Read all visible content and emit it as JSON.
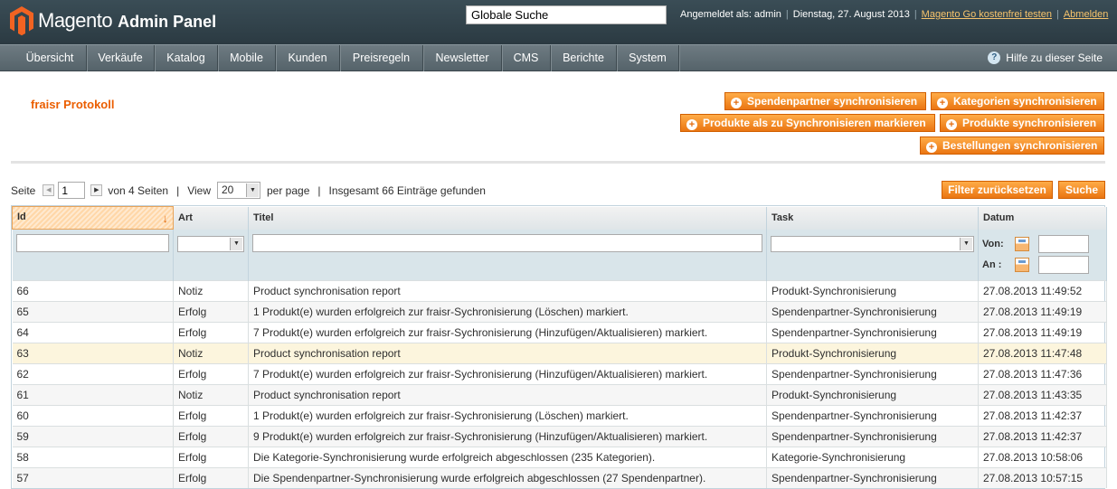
{
  "header": {
    "logo_text": "Magento",
    "logo_sub": "Admin Panel",
    "search_value": "Globale Suche",
    "logged_in": "Angemeldet als: admin",
    "date": "Dienstag, 27. August 2013",
    "go_link": "Magento Go kostenfrei testen",
    "logout": "Abmelden"
  },
  "nav": {
    "items": [
      "Übersicht",
      "Verkäufe",
      "Katalog",
      "Mobile",
      "Kunden",
      "Preisregeln",
      "Newsletter",
      "CMS",
      "Berichte",
      "System"
    ],
    "help": "Hilfe zu dieser Seite"
  },
  "page": {
    "title": "fraisr Protokoll",
    "buttons": {
      "sync_partners": "Spendenpartner synchronisieren",
      "sync_categories": "Kategorien synchronisieren",
      "mark_products": "Produkte als zu Synchronisieren markieren",
      "sync_products": "Produkte synchronisieren",
      "sync_orders": "Bestellungen synchronisieren"
    }
  },
  "pager": {
    "page_label": "Seite",
    "page_value": "1",
    "of_pages": "von 4 Seiten",
    "view_label": "View",
    "view_value": "20",
    "per_page": "per page",
    "total": "Insgesamt 66 Einträge gefunden",
    "reset_filter": "Filter zurücksetzen",
    "search": "Suche"
  },
  "grid": {
    "columns": [
      "Id",
      "Art",
      "Titel",
      "Task",
      "Datum"
    ],
    "date_from": "Von:",
    "date_to": "An :",
    "rows": [
      [
        "66",
        "Notiz",
        "Product synchronisation report",
        "Produkt-Synchronisierung",
        "27.08.2013 11:49:52"
      ],
      [
        "65",
        "Erfolg",
        "1 Produkt(e) wurden erfolgreich zur fraisr-Sychronisierung (Löschen) markiert.",
        "Spendenpartner-Synchronisierung",
        "27.08.2013 11:49:19"
      ],
      [
        "64",
        "Erfolg",
        "7 Produkt(e) wurden erfolgreich zur fraisr-Sychronisierung (Hinzufügen/Aktualisieren) markiert.",
        "Spendenpartner-Synchronisierung",
        "27.08.2013 11:49:19"
      ],
      [
        "63",
        "Notiz",
        "Product synchronisation report",
        "Produkt-Synchronisierung",
        "27.08.2013 11:47:48"
      ],
      [
        "62",
        "Erfolg",
        "7 Produkt(e) wurden erfolgreich zur fraisr-Sychronisierung (Hinzufügen/Aktualisieren) markiert.",
        "Spendenpartner-Synchronisierung",
        "27.08.2013 11:47:36"
      ],
      [
        "61",
        "Notiz",
        "Product synchronisation report",
        "Produkt-Synchronisierung",
        "27.08.2013 11:43:35"
      ],
      [
        "60",
        "Erfolg",
        "1 Produkt(e) wurden erfolgreich zur fraisr-Sychronisierung (Löschen) markiert.",
        "Spendenpartner-Synchronisierung",
        "27.08.2013 11:42:37"
      ],
      [
        "59",
        "Erfolg",
        "9 Produkt(e) wurden erfolgreich zur fraisr-Sychronisierung (Hinzufügen/Aktualisieren) markiert.",
        "Spendenpartner-Synchronisierung",
        "27.08.2013 11:42:37"
      ],
      [
        "58",
        "Erfolg",
        "Die Kategorie-Synchronisierung wurde erfolgreich abgeschlossen (235 Kategorien).",
        "Kategorie-Synchronisierung",
        "27.08.2013 10:58:06"
      ],
      [
        "57",
        "Erfolg",
        "Die Spendenpartner-Synchronisierung wurde erfolgreich abgeschlossen (27 Spendenpartner).",
        "Spendenpartner-Synchronisierung",
        "27.08.2013 10:57:15"
      ]
    ]
  },
  "colors": {
    "accent": "#eb5e00",
    "button": "#f18200",
    "header": "#2b3a42",
    "nav": "#5f6c73"
  }
}
